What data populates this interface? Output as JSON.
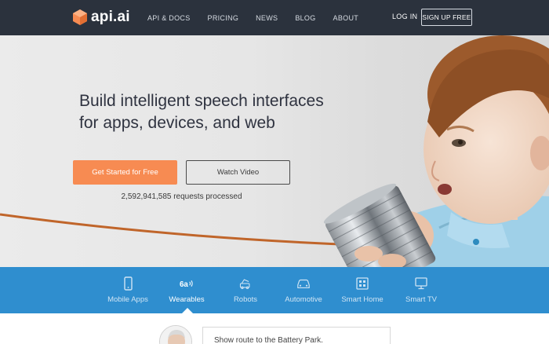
{
  "nav": {
    "logo_text": "api.ai",
    "links": [
      "API & DOCS",
      "PRICING",
      "NEWS",
      "BLOG",
      "ABOUT"
    ],
    "login": "LOG IN",
    "signup": "SIGN UP FREE"
  },
  "hero": {
    "headline_line1": "Build intelligent speech interfaces",
    "headline_line2": "for apps, devices, and web",
    "start_button": "Get Started for Free",
    "video_button": "Watch Video",
    "requests": "2,592,941,585 requests processed"
  },
  "categories": {
    "items": [
      {
        "label": "Mobile Apps",
        "icon": "mobile-icon"
      },
      {
        "label": "Wearables",
        "icon": "wearables-icon"
      },
      {
        "label": "Robots",
        "icon": "robot-icon"
      },
      {
        "label": "Automotive",
        "icon": "car-icon"
      },
      {
        "label": "Smart Home",
        "icon": "smart-home-icon"
      },
      {
        "label": "Smart TV",
        "icon": "tv-icon"
      }
    ],
    "active": "Wearables"
  },
  "demo": {
    "query": "Show route to the Battery Park."
  },
  "colors": {
    "nav_bg": "#2b323d",
    "accent_orange": "#f78b52",
    "category_blue": "#2f8ecf"
  }
}
